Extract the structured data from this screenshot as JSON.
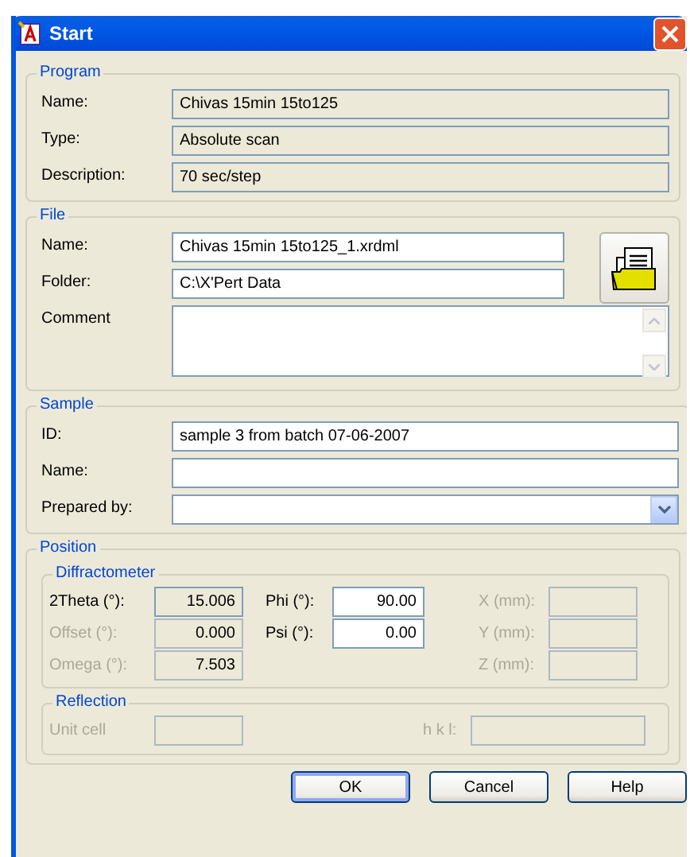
{
  "window": {
    "title": "Start"
  },
  "program": {
    "title": "Program",
    "fields": [
      {
        "label": "Name:",
        "value": "Chivas 15min 15to125",
        "kind": "text",
        "readonly": true
      },
      {
        "label": "Type:",
        "value": "Absolute scan",
        "kind": "text",
        "readonly": true
      },
      {
        "label": "Description:",
        "value": "70 sec/step",
        "kind": "text",
        "readonly": true
      }
    ]
  },
  "file": {
    "title": "File",
    "fields": [
      {
        "label": "Name:",
        "value": "Chivas 15min 15to125_1.xrdml",
        "kind": "text",
        "readonly": false
      },
      {
        "label": "Folder:",
        "value": "C:\\X'Pert Data",
        "kind": "text",
        "readonly": false
      },
      {
        "label": "Comment",
        "kind": "memo",
        "readonly": false
      }
    ]
  },
  "sample": {
    "title": "Sample",
    "fields": [
      {
        "label": "ID:",
        "value": "sample 3 from batch 07-06-2007",
        "kind": "text",
        "readonly": false
      },
      {
        "label": "Name:",
        "kind": "text",
        "readonly": false
      },
      {
        "label": "Prepared by:",
        "kind": "combo",
        "readonly": false
      }
    ]
  },
  "position": {
    "title": "Position",
    "diffractometer": {
      "title": "Diffractometer",
      "columns": [
        [
          {
            "label": "2Theta (°):",
            "value": "15.006",
            "disabled": false,
            "readonly": true
          },
          {
            "label": "Offset (°):",
            "value": "0.000",
            "disabled": true,
            "readonly": true
          },
          {
            "label": "Omega (°):",
            "value": "7.503",
            "disabled": true,
            "readonly": true
          }
        ],
        [
          {
            "label": "Phi (°):",
            "value": "90.00",
            "disabled": false,
            "readonly": false
          },
          {
            "label": "Psi (°):",
            "value": "0.00",
            "disabled": false,
            "readonly": false
          }
        ],
        [
          {
            "label": "X (mm):",
            "disabled": true,
            "readonly": true
          },
          {
            "label": "Y (mm):",
            "disabled": true,
            "readonly": true
          },
          {
            "label": "Z (mm):",
            "disabled": true,
            "readonly": true
          }
        ]
      ]
    },
    "reflection": {
      "title": "Reflection",
      "fields": [
        {
          "label": "Unit cell",
          "disabled": true,
          "readonly": true
        },
        {
          "label": "h k l:",
          "disabled": true,
          "readonly": true
        }
      ]
    }
  },
  "buttons": [
    {
      "label": "OK",
      "default": true
    },
    {
      "label": "Cancel",
      "default": false
    },
    {
      "label": "Help",
      "default": false
    }
  ]
}
